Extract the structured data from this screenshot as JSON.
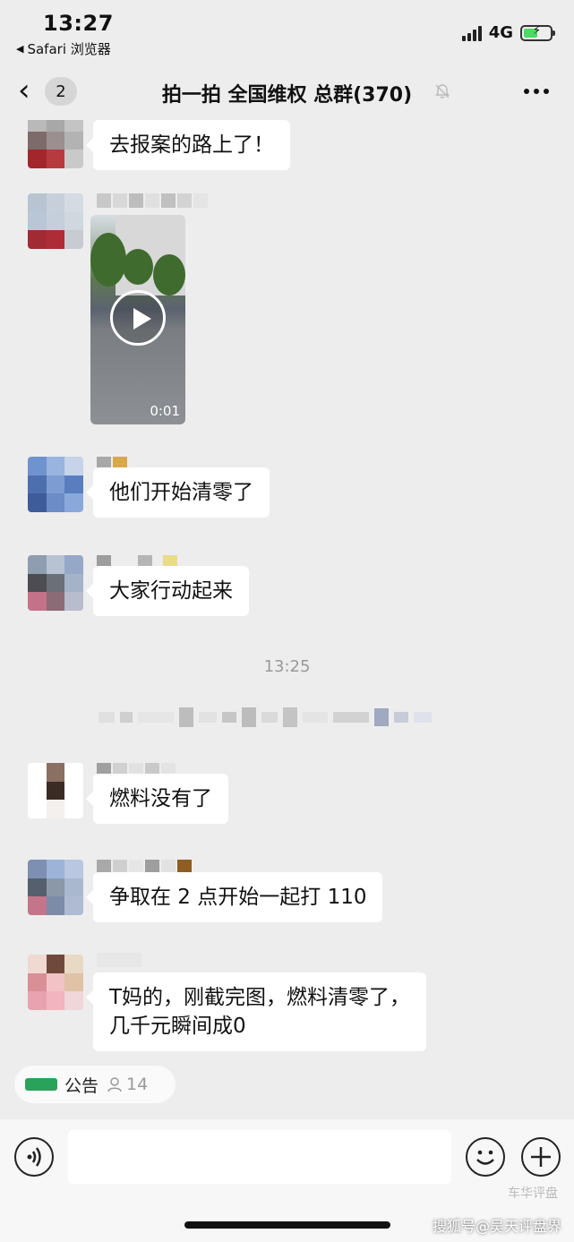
{
  "status_bar": {
    "time": "13:27",
    "back_app": "Safari 浏览器",
    "network": "4G"
  },
  "header": {
    "unread_count": "2",
    "title": "拍一拍 全国维权 总群(370)"
  },
  "messages": [
    {
      "text": "去报案的路上了！"
    },
    {
      "video_duration": "0:01"
    },
    {
      "text": "他们开始清零了"
    },
    {
      "text": "大家行动起来"
    },
    {
      "text": "燃料没有了"
    },
    {
      "text": "争取在 2 点开始一起打 110"
    },
    {
      "text": "T妈的，刚截完图，燃料清零了，\n几千元瞬间成0"
    }
  ],
  "timestamp": "13:25",
  "announcement": {
    "label": "公告",
    "member_count": "14"
  },
  "watermark": "搜狐号@吴天评盘界",
  "watermark_faded": "车华评盘"
}
